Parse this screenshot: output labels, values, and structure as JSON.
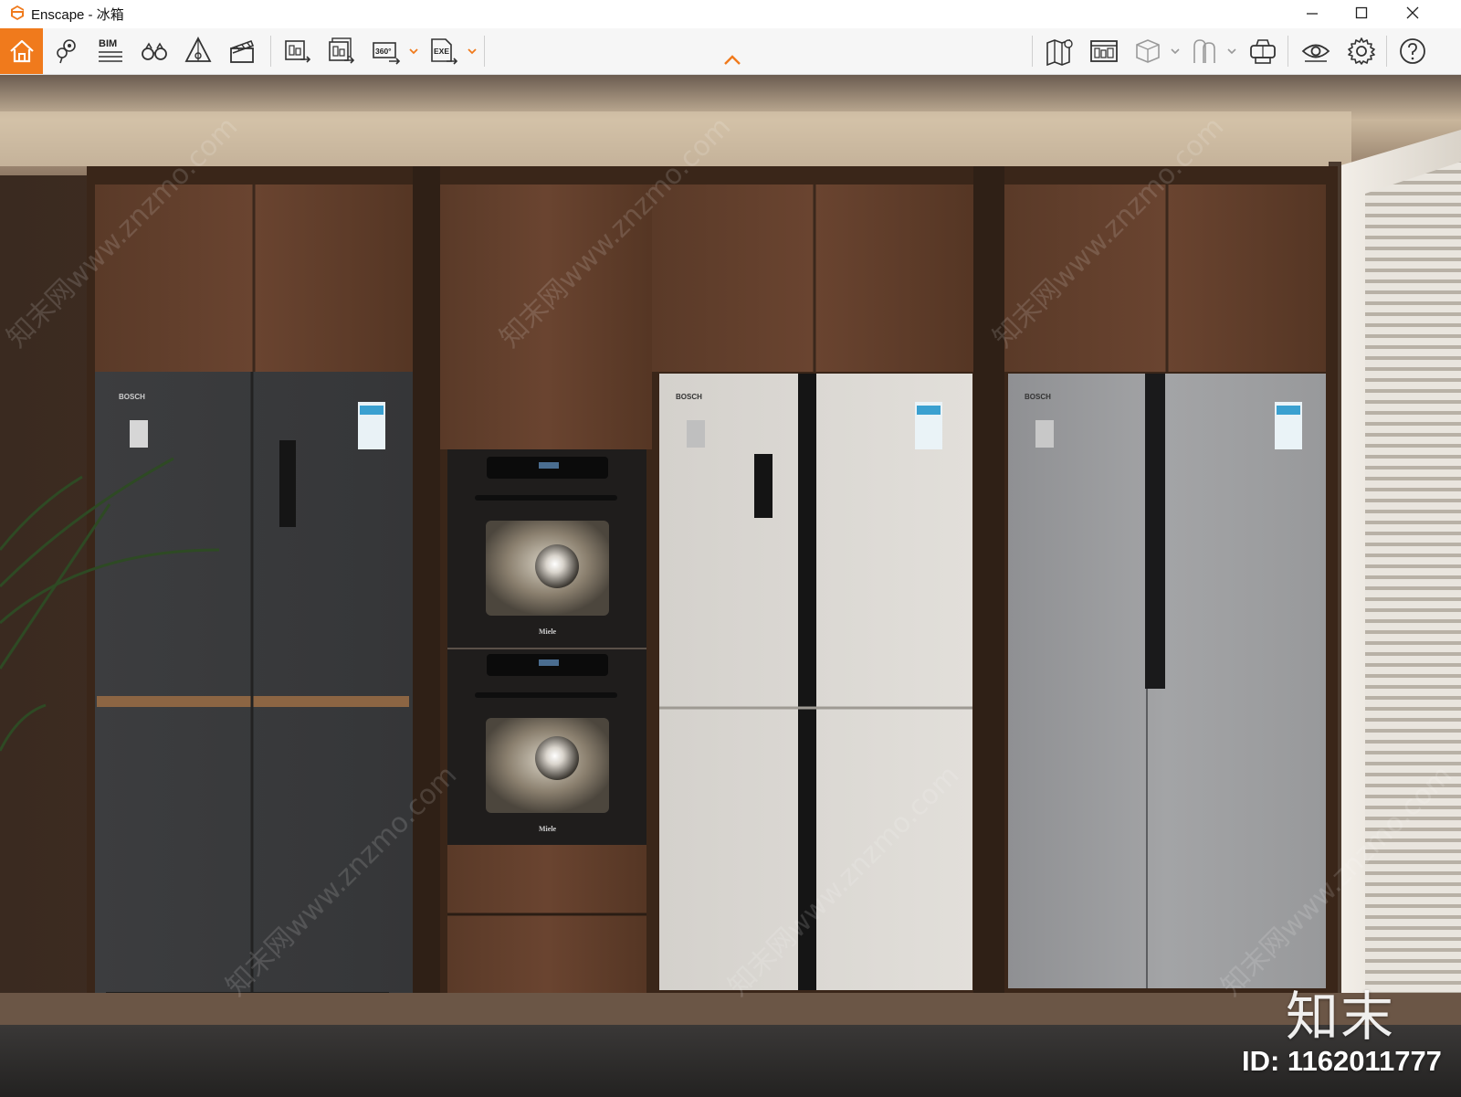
{
  "window": {
    "app_name": "Enscape",
    "title": "Enscape - 冰箱",
    "controls": [
      "minimize",
      "maximize",
      "close"
    ]
  },
  "toolbar": {
    "left_tools": [
      {
        "name": "home-icon",
        "label": ""
      },
      {
        "name": "location-pin-icon",
        "label": ""
      },
      {
        "name": "bim-icon",
        "label": "BIM"
      },
      {
        "name": "binoculars-icon",
        "label": ""
      },
      {
        "name": "asset-library-icon",
        "label": ""
      },
      {
        "name": "video-clapper-icon",
        "label": ""
      },
      {
        "name": "export-image-icon",
        "label": ""
      },
      {
        "name": "batch-render-icon",
        "label": ""
      },
      {
        "name": "panorama-360-icon",
        "label": "360°"
      },
      {
        "name": "export-exe-icon",
        "label": "EXE"
      }
    ],
    "right_tools": [
      {
        "name": "map-icon"
      },
      {
        "name": "views-icon"
      },
      {
        "name": "cube-icon"
      },
      {
        "name": "people-icon"
      },
      {
        "name": "vr-headset-icon"
      },
      {
        "name": "visibility-eye-icon"
      },
      {
        "name": "settings-gear-icon"
      },
      {
        "name": "help-icon"
      }
    ],
    "accent_color": "#f07a1c"
  },
  "scene": {
    "appliances": [
      {
        "brand": "BOSCH",
        "type": "four-door refrigerator",
        "finish": "dark graphite"
      },
      {
        "brand": "Miele",
        "type": "double wall oven"
      },
      {
        "brand": "BOSCH",
        "type": "cross-door refrigerator",
        "finish": "white"
      },
      {
        "brand": "BOSCH",
        "type": "side-by-side refrigerator",
        "finish": "stainless"
      }
    ],
    "oven_brand_1": "Miele",
    "oven_brand_2": "Miele",
    "fridge1_brand": "BOSCH",
    "fridge2_brand": "BOSCH",
    "fridge3_brand": "BOSCH"
  },
  "watermark": {
    "logo_text": "知末",
    "id_text": "ID: 1162011777",
    "diagonal_text": "知末网www.znzmo.com"
  }
}
